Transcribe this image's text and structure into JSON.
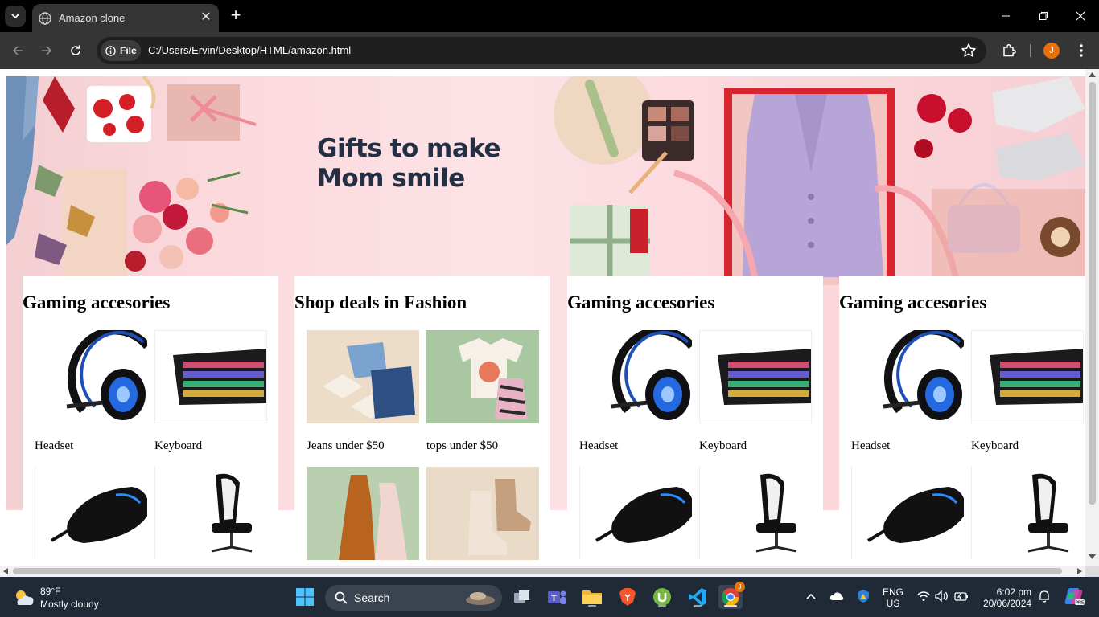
{
  "browser": {
    "tab_title": "Amazon clone",
    "chip_label": "File",
    "url": "C:/Users/Ervin/Desktop/HTML/amazon.html",
    "profile_initial": "J",
    "accent": "#e8710a"
  },
  "hero": {
    "title_line1": "Gifts to make",
    "title_line2": "Mom smile"
  },
  "cards": [
    {
      "title": "Gaming accesories",
      "tiles": [
        {
          "label": "Headset",
          "icon": "headset-icon"
        },
        {
          "label": "Keyboard",
          "icon": "keyboard-icon"
        },
        {
          "label": "",
          "icon": "mouse-icon"
        },
        {
          "label": "",
          "icon": "gaming-chair-icon"
        }
      ]
    },
    {
      "title": "Shop deals in Fashion",
      "tiles": [
        {
          "label": "Jeans under $50",
          "icon": "jeans-icon"
        },
        {
          "label": "tops under $50",
          "icon": "tops-icon"
        },
        {
          "label": "",
          "icon": "dress-icon"
        },
        {
          "label": "",
          "icon": "boots-icon"
        }
      ]
    },
    {
      "title": "Gaming accesories",
      "tiles": [
        {
          "label": "Headset",
          "icon": "headset-icon"
        },
        {
          "label": "Keyboard",
          "icon": "keyboard-icon"
        },
        {
          "label": "",
          "icon": "mouse-icon"
        },
        {
          "label": "",
          "icon": "gaming-chair-icon"
        }
      ]
    },
    {
      "title": "Gaming accesories",
      "tiles": [
        {
          "label": "Headset",
          "icon": "headset-icon"
        },
        {
          "label": "Keyboard",
          "icon": "keyboard-icon"
        },
        {
          "label": "",
          "icon": "mouse-icon"
        },
        {
          "label": "",
          "icon": "gaming-chair-icon"
        }
      ]
    }
  ],
  "taskbar": {
    "temperature": "89°F",
    "weather": "Mostly cloudy",
    "search_placeholder": "Search",
    "lang_line1": "ENG",
    "lang_line2": "US",
    "time": "6:02 pm",
    "date": "20/06/2024"
  }
}
